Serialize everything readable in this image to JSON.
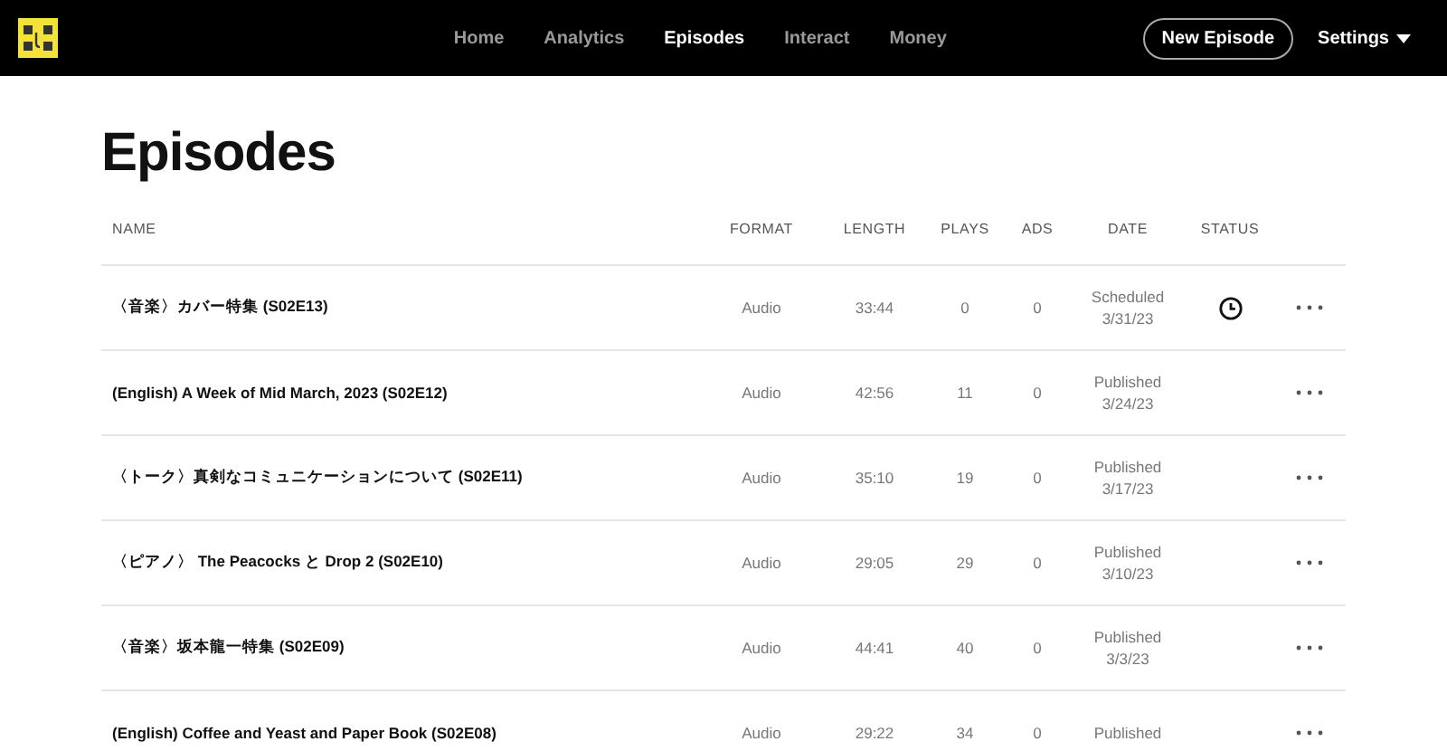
{
  "nav": {
    "items": [
      {
        "label": "Home",
        "selected": false
      },
      {
        "label": "Analytics",
        "selected": false
      },
      {
        "label": "Episodes",
        "selected": true
      },
      {
        "label": "Interact",
        "selected": false
      },
      {
        "label": "Money",
        "selected": false
      }
    ],
    "new_button": "New Episode",
    "settings": "Settings"
  },
  "page_title": "Episodes",
  "table": {
    "columns": [
      "NAME",
      "FORMAT",
      "LENGTH",
      "PLAYS",
      "ADS",
      "DATE",
      "STATUS"
    ],
    "rows": [
      {
        "name": "〈音楽〉カバー特集 (S02E13)",
        "format": "Audio",
        "length": "33:44",
        "plays": "0",
        "ads": "0",
        "date_status": "Scheduled",
        "date": "3/31/23",
        "scheduled": true
      },
      {
        "name": "(English) A Week of Mid March, 2023 (S02E12)",
        "format": "Audio",
        "length": "42:56",
        "plays": "11",
        "ads": "0",
        "date_status": "Published",
        "date": "3/24/23",
        "scheduled": false
      },
      {
        "name": "〈トーク〉真剣なコミュニケーションについて (S02E11)",
        "format": "Audio",
        "length": "35:10",
        "plays": "19",
        "ads": "0",
        "date_status": "Published",
        "date": "3/17/23",
        "scheduled": false
      },
      {
        "name": "〈ピアノ〉 The Peacocks と Drop 2 (S02E10)",
        "format": "Audio",
        "length": "29:05",
        "plays": "29",
        "ads": "0",
        "date_status": "Published",
        "date": "3/10/23",
        "scheduled": false
      },
      {
        "name": "〈音楽〉坂本龍一特集 (S02E09)",
        "format": "Audio",
        "length": "44:41",
        "plays": "40",
        "ads": "0",
        "date_status": "Published",
        "date": "3/3/23",
        "scheduled": false
      },
      {
        "name": "(English) Coffee and Yeast and Paper Book (S02E08)",
        "format": "Audio",
        "length": "29:22",
        "plays": "34",
        "ads": "0",
        "date_status": "Published",
        "scheduled": false
      }
    ]
  }
}
